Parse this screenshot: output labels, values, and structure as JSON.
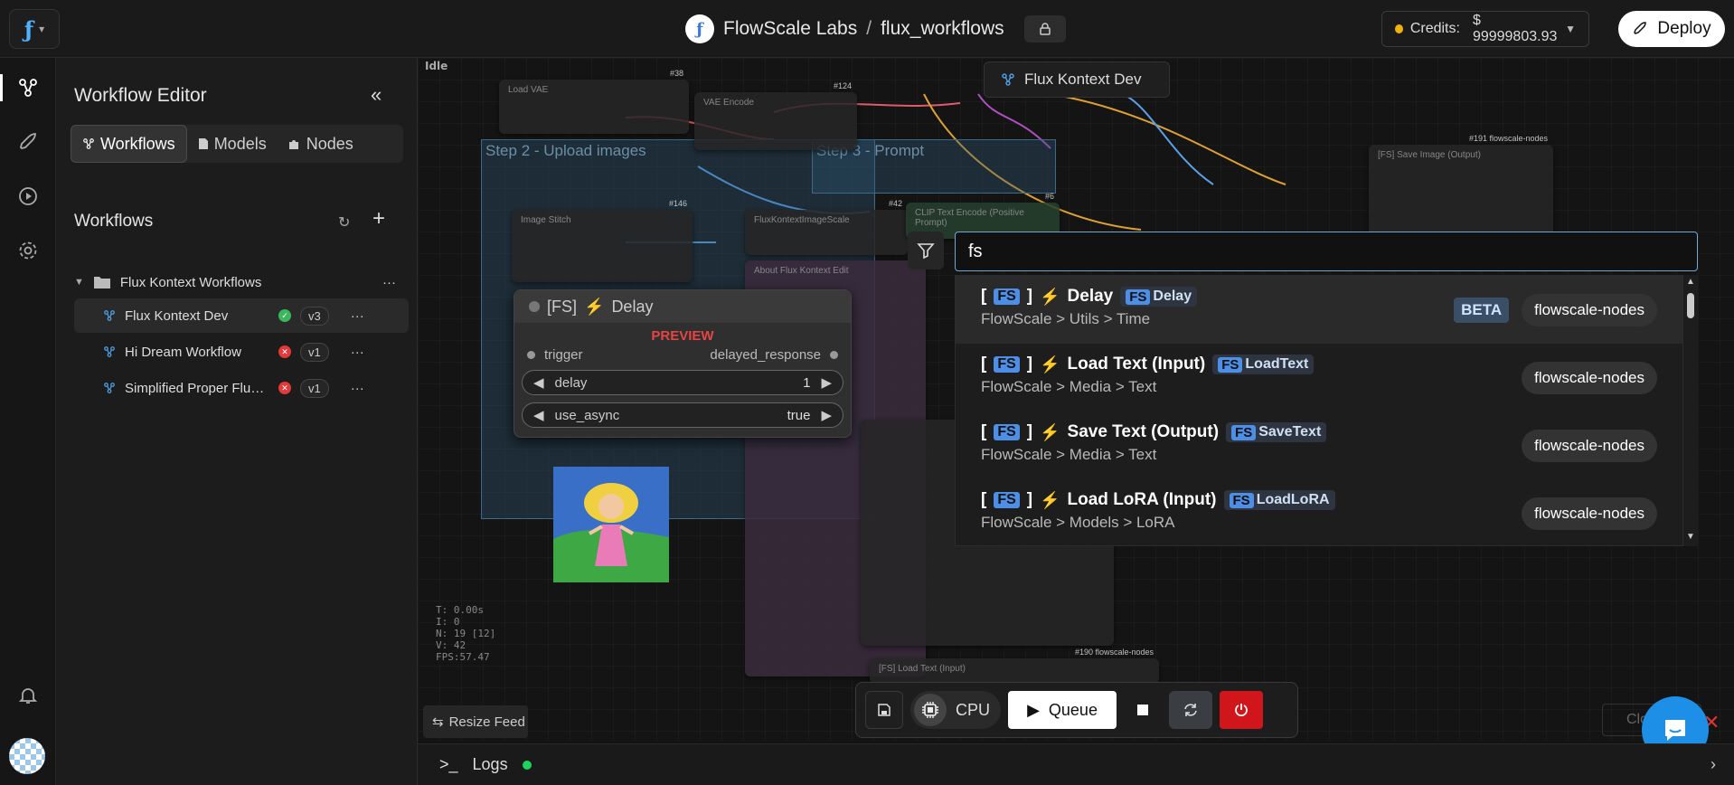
{
  "header": {
    "org": "FlowScale Labs",
    "separator": "/",
    "project": "flux_workflows",
    "credits_label": "Credits:",
    "credits_value": "$ 99999803.93",
    "deploy_label": "Deploy"
  },
  "sidebar": {
    "title": "Workflow Editor",
    "tabs": [
      {
        "label": "Workflows"
      },
      {
        "label": "Models"
      },
      {
        "label": "Nodes"
      }
    ],
    "section_title": "Workflows",
    "folder": "Flux Kontext Workflows",
    "workflows": [
      {
        "name": "Flux Kontext Dev",
        "status": "ok",
        "version": "v3"
      },
      {
        "name": "Hi Dream Workflow",
        "status": "error",
        "version": "v1"
      },
      {
        "name": "Simplified Proper Flux Kontext",
        "status": "error",
        "version": "v1"
      }
    ]
  },
  "canvas": {
    "status": "Idle",
    "active_workflow_tag": "Flux Kontext Dev",
    "groups": [
      {
        "title": "Step 2 - Upload images"
      },
      {
        "title": "Step 3 - Prompt"
      }
    ],
    "nodes": [
      {
        "title": "Load VAE",
        "id": "#38"
      },
      {
        "title": "VAE Encode",
        "id": "#124"
      },
      {
        "title": "Image Stitch",
        "id": "#146"
      },
      {
        "title": "FluxKontextImageScale",
        "id": "#42"
      },
      {
        "title": "About Flux Kontext Edit",
        "id": ""
      },
      {
        "title": "CLIP Text Encode (Positive Prompt)",
        "id": "#6"
      },
      {
        "title": "[FS] Save Image (Output)",
        "id": "#191 flowscale-nodes"
      },
      {
        "title": "[FS] Load Text (Input)",
        "id": "#190 flowscale-nodes"
      }
    ],
    "stats": [
      "T: 0.00s",
      "I: 0",
      "N: 19 [12]",
      "V: 42",
      "FPS:57.47"
    ]
  },
  "delay_node": {
    "title": "[FS]",
    "title_suffix": "Delay",
    "preview_label": "PREVIEW",
    "input": "trigger",
    "output": "delayed_response",
    "widgets": [
      {
        "name": "delay",
        "value": "1"
      },
      {
        "name": "use_async",
        "value": "true"
      }
    ]
  },
  "search": {
    "query": "fs",
    "results": [
      {
        "bracket_open": "[",
        "fs": "FS",
        "bracket_close": "]",
        "name": "Delay",
        "class_fs": "FS",
        "class_name": "Delay",
        "path": "FlowScale > Utils > Time",
        "beta": "BETA",
        "package": "flowscale-nodes"
      },
      {
        "bracket_open": "[",
        "fs": "FS",
        "bracket_close": "]",
        "name": "Load Text (Input)",
        "class_fs": "FS",
        "class_name": "LoadText",
        "path": "FlowScale > Media > Text",
        "beta": "",
        "package": "flowscale-nodes"
      },
      {
        "bracket_open": "[",
        "fs": "FS",
        "bracket_close": "]",
        "name": "Save Text (Output)",
        "class_fs": "FS",
        "class_name": "SaveText",
        "path": "FlowScale > Media > Text",
        "beta": "",
        "package": "flowscale-nodes"
      },
      {
        "bracket_open": "[",
        "fs": "FS",
        "bracket_close": "]",
        "name": "Load LoRA (Input)",
        "class_fs": "FS",
        "class_name": "LoadLoRA",
        "path": "FlowScale > Models > LoRA",
        "beta": "",
        "package": "flowscale-nodes"
      }
    ]
  },
  "toolbar": {
    "cpu_label": "CPU",
    "queue_label": "Queue"
  },
  "footer": {
    "resize_feed": "Resize Feed",
    "close_label": "Clo",
    "logs_label": "Logs"
  },
  "colors": {
    "accent": "#4d8fe6",
    "ok": "#3cb85c",
    "error": "#e03a3a",
    "power": "#d0161a",
    "logs_online": "#1fd25c"
  }
}
